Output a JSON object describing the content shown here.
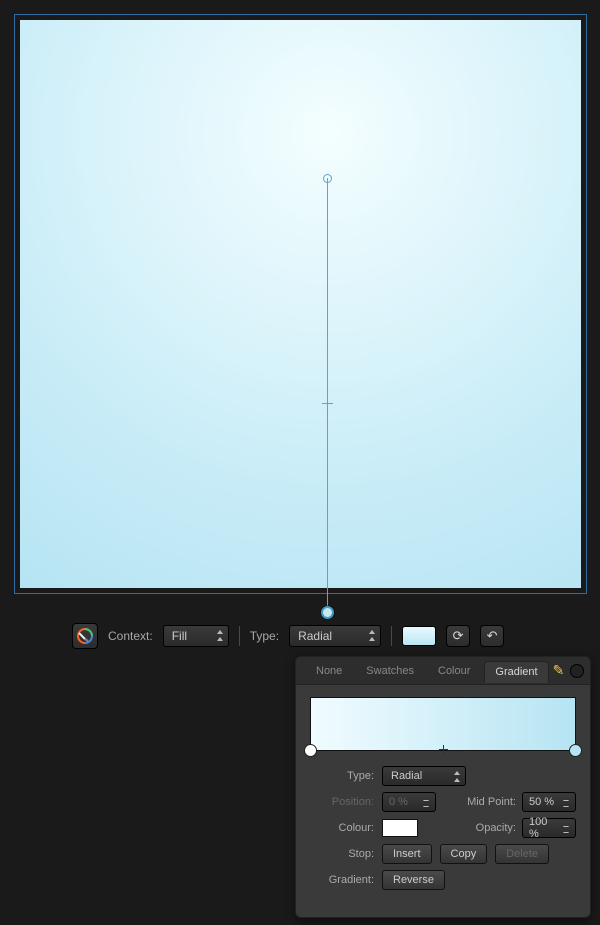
{
  "contextBar": {
    "contextLabel": "Context:",
    "contextValue": "Fill",
    "typeLabel": "Type:",
    "typeValue": "Radial"
  },
  "panel": {
    "tabs": {
      "none": "None",
      "swatches": "Swatches",
      "colour": "Colour",
      "gradient": "Gradient"
    },
    "form": {
      "typeLabel": "Type:",
      "typeValue": "Radial",
      "positionLabel": "Position:",
      "positionValue": "0 %",
      "midPointLabel": "Mid Point:",
      "midPointValue": "50 %",
      "colourLabel": "Colour:",
      "opacityLabel": "Opacity:",
      "opacityValue": "100 %",
      "stopLabel": "Stop:",
      "insert": "Insert",
      "copy": "Copy",
      "delete": "Delete",
      "gradientLabel": "Gradient:",
      "reverse": "Reverse"
    }
  },
  "colors": {
    "gradStart": "#f0fcff",
    "gradEnd": "#b6e4f3"
  }
}
